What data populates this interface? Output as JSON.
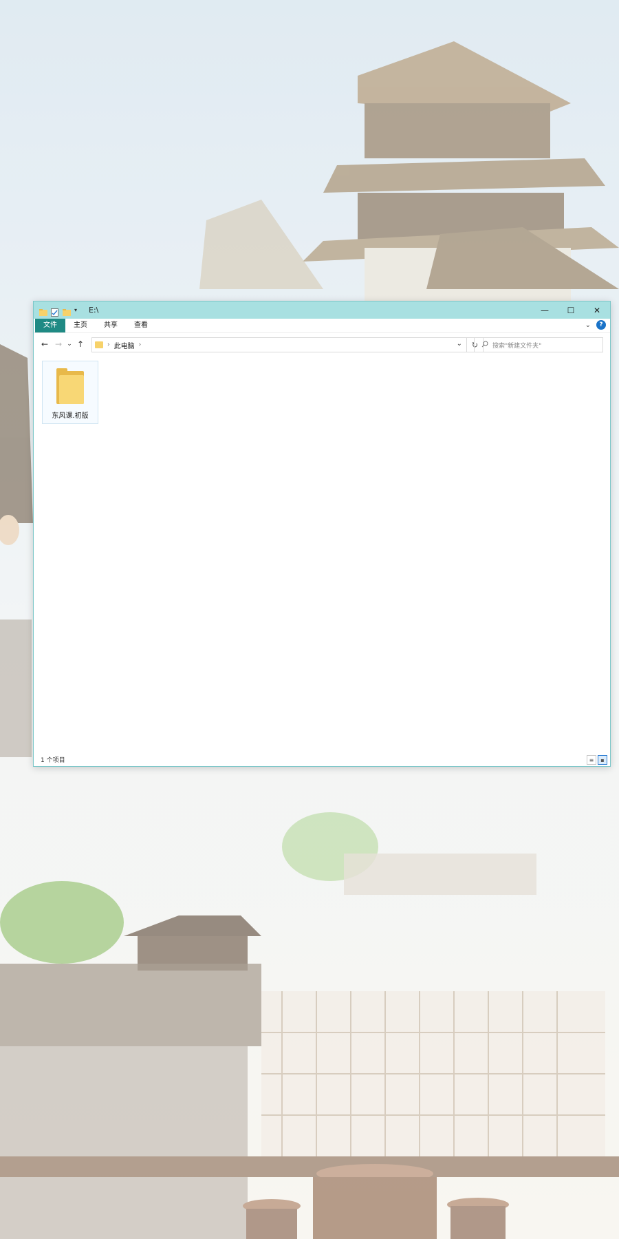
{
  "window": {
    "title_path": "E:\\",
    "controls": {
      "minimize": "—",
      "maximize": "☐",
      "close": "✕"
    }
  },
  "ribbon": {
    "tabs": [
      "文件",
      "主页",
      "共享",
      "查看"
    ],
    "expand_glyph": "⌄",
    "help": "?"
  },
  "nav": {
    "back": "←",
    "forward": "→",
    "recent": "⌄",
    "up": "↑",
    "breadcrumb": "此电脑",
    "refresh": "↻",
    "search_placeholder": "搜索\"新建文件夹\""
  },
  "items": [
    {
      "name": "东风课.初版"
    }
  ],
  "status": {
    "count_text": "1 个项目"
  },
  "colors": {
    "titlebar": "#a8e0e1",
    "active_tab": "#1f8a84",
    "folder": "#f7d26a"
  }
}
